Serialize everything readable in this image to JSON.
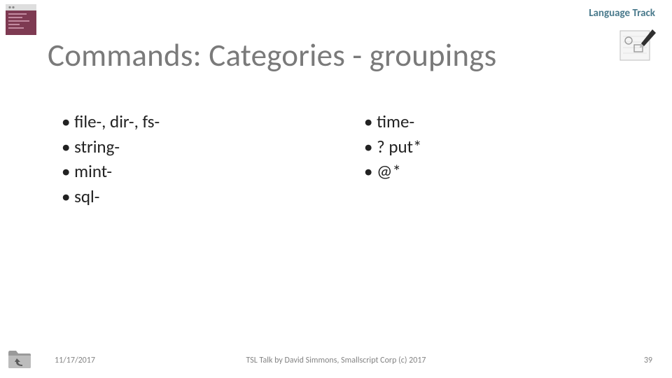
{
  "header": {
    "track": "Language Track",
    "title": "Commands: Categories - groupings"
  },
  "columns": {
    "left": [
      "file-, dir-, fs-",
      "string-",
      "mint-",
      "sql-"
    ],
    "right": [
      "time-",
      "? put*",
      "@*"
    ]
  },
  "footer": {
    "date": "11/17/2017",
    "attribution": "TSL Talk by David Simmons, Smallscript Corp (c) 2017",
    "page": "39"
  }
}
